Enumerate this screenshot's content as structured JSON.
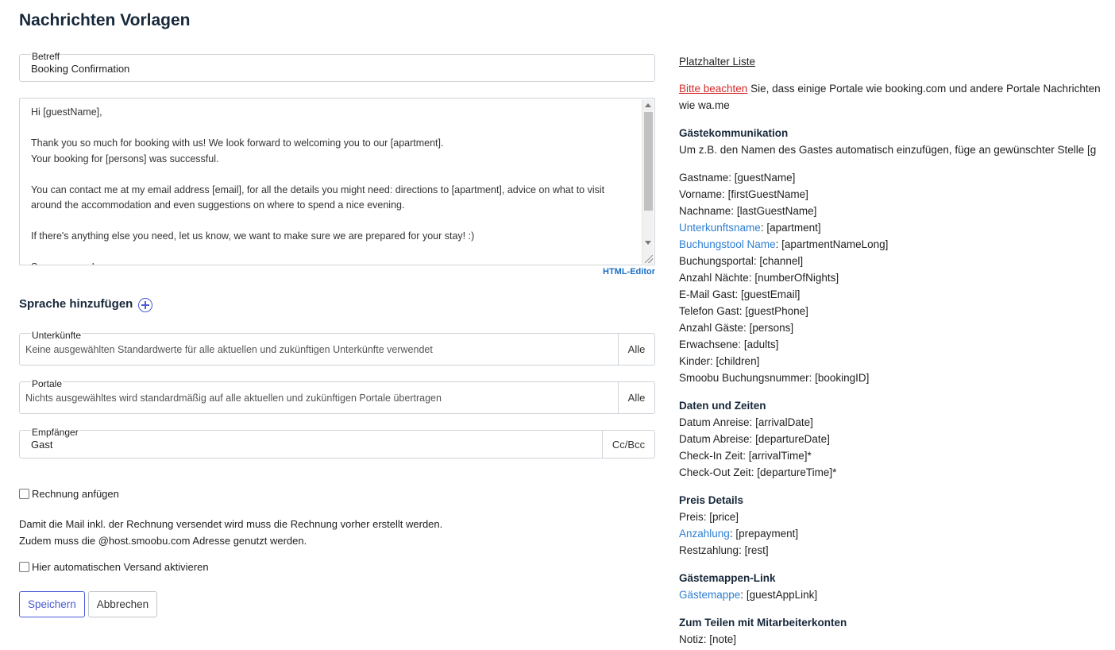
{
  "page": {
    "title": "Nachrichten Vorlagen"
  },
  "subject": {
    "label": "Betreff",
    "value": "Booking Confirmation"
  },
  "editor": {
    "lines": [
      "Hi [guestName],",
      "",
      "Thank you so much for booking with us! We look forward to welcoming you to our [apartment].",
      "Your booking for [persons] was successful.",
      "",
      "You can contact me at my email address [email], for all the details you might need: directions to [apartment], advice on what to visit",
      "around the accommodation and even suggestions on where to spend a nice evening.",
      "",
      "If there's anything else you need, let us know, we want to make sure we are prepared for your stay! :)",
      "",
      "See you soon!"
    ],
    "html_editor_label": "HTML-Editor"
  },
  "language": {
    "title": "Sprache hinzufügen"
  },
  "accommodations": {
    "label": "Unterkünfte",
    "placeholder": "Keine ausgewählten Standardwerte für alle aktuellen und zukünftigen Unterkünfte verwendet",
    "addon": "Alle"
  },
  "portals": {
    "label": "Portale",
    "placeholder": "Nichts ausgewähltes wird standardmäßig auf alle aktuellen und zukünftigen Portale übertragen",
    "addon": "Alle"
  },
  "recipient": {
    "label": "Empfänger",
    "value": "Gast",
    "addon": "Cc/Bcc"
  },
  "invoice": {
    "checkbox_label": "Rechnung anfügen",
    "note_line1": "Damit die Mail inkl. der Rechnung versendet wird muss die Rechnung vorher erstellt werden.",
    "note_line2": "Zudem muss die @host.smoobu.com Adresse genutzt werden."
  },
  "auto_send": {
    "checkbox_label": "Hier automatischen Versand aktivieren"
  },
  "buttons": {
    "save": "Speichern",
    "cancel": "Abbrechen"
  },
  "placeholders": {
    "list_link": "Platzhalter Liste",
    "notice_link": "Bitte beachten",
    "notice_text": " Sie, dass einige Portale wie booking.com und andere Portale Nachrichten",
    "notice_line2": "wie wa.me",
    "guest": {
      "title": "Gästekommunikation",
      "intro": "Um z.B. den Namen des Gastes automatisch einzufügen, füge an gewünschter Stelle [g",
      "items": [
        {
          "label": "Gastname",
          "token": "[guestName]",
          "link": false
        },
        {
          "label": "Vorname",
          "token": "[firstGuestName]",
          "link": false
        },
        {
          "label": "Nachname",
          "token": "[lastGuestName]",
          "link": false
        },
        {
          "label": "Unterkunftsname",
          "token": "[apartment]",
          "link": true
        },
        {
          "label": "Buchungstool Name",
          "token": "[apartmentNameLong]",
          "link": true
        },
        {
          "label": "Buchungsportal",
          "token": "[channel]",
          "link": false
        },
        {
          "label": "Anzahl Nächte",
          "token": "[numberOfNights]",
          "link": false
        },
        {
          "label": "E-Mail Gast",
          "token": "[guestEmail]",
          "link": false
        },
        {
          "label": "Telefon Gast",
          "token": "[guestPhone]",
          "link": false
        },
        {
          "label": "Anzahl Gäste",
          "token": "[persons]",
          "link": false
        },
        {
          "label": "Erwachsene",
          "token": "[adults]",
          "link": false
        },
        {
          "label": "Kinder",
          "token": "[children]",
          "link": false
        },
        {
          "label": "Smoobu Buchungsnummer",
          "token": "[bookingID]",
          "link": false
        }
      ]
    },
    "dates": {
      "title": "Daten und Zeiten",
      "items": [
        {
          "label": "Datum Anreise",
          "token": "[arrivalDate]",
          "link": false
        },
        {
          "label": "Datum Abreise",
          "token": "[departureDate]",
          "link": false
        },
        {
          "label": "Check-In Zeit",
          "token": "[arrivalTime]*",
          "link": false
        },
        {
          "label": "Check-Out Zeit",
          "token": "[departureTime]*",
          "link": false
        }
      ]
    },
    "price": {
      "title": "Preis Details",
      "items": [
        {
          "label": "Preis",
          "token": "[price]",
          "link": false
        },
        {
          "label": "Anzahlung",
          "token": "[prepayment]",
          "link": true
        },
        {
          "label": "Restzahlung",
          "token": "[rest]",
          "link": false
        }
      ]
    },
    "guestbook": {
      "title": "Gästemappen-Link",
      "items": [
        {
          "label": "Gästemappe",
          "token": "[guestAppLink]",
          "link": true
        }
      ]
    },
    "staff": {
      "title": "Zum Teilen mit Mitarbeiterkonten",
      "items": [
        {
          "label": "Notiz",
          "token": "[note]",
          "link": false
        }
      ]
    }
  },
  "colors": {
    "accent": "#4a5bd4",
    "link_blue": "#2d7fd3",
    "warning_red": "#d42a2a",
    "title": "#17283a"
  }
}
